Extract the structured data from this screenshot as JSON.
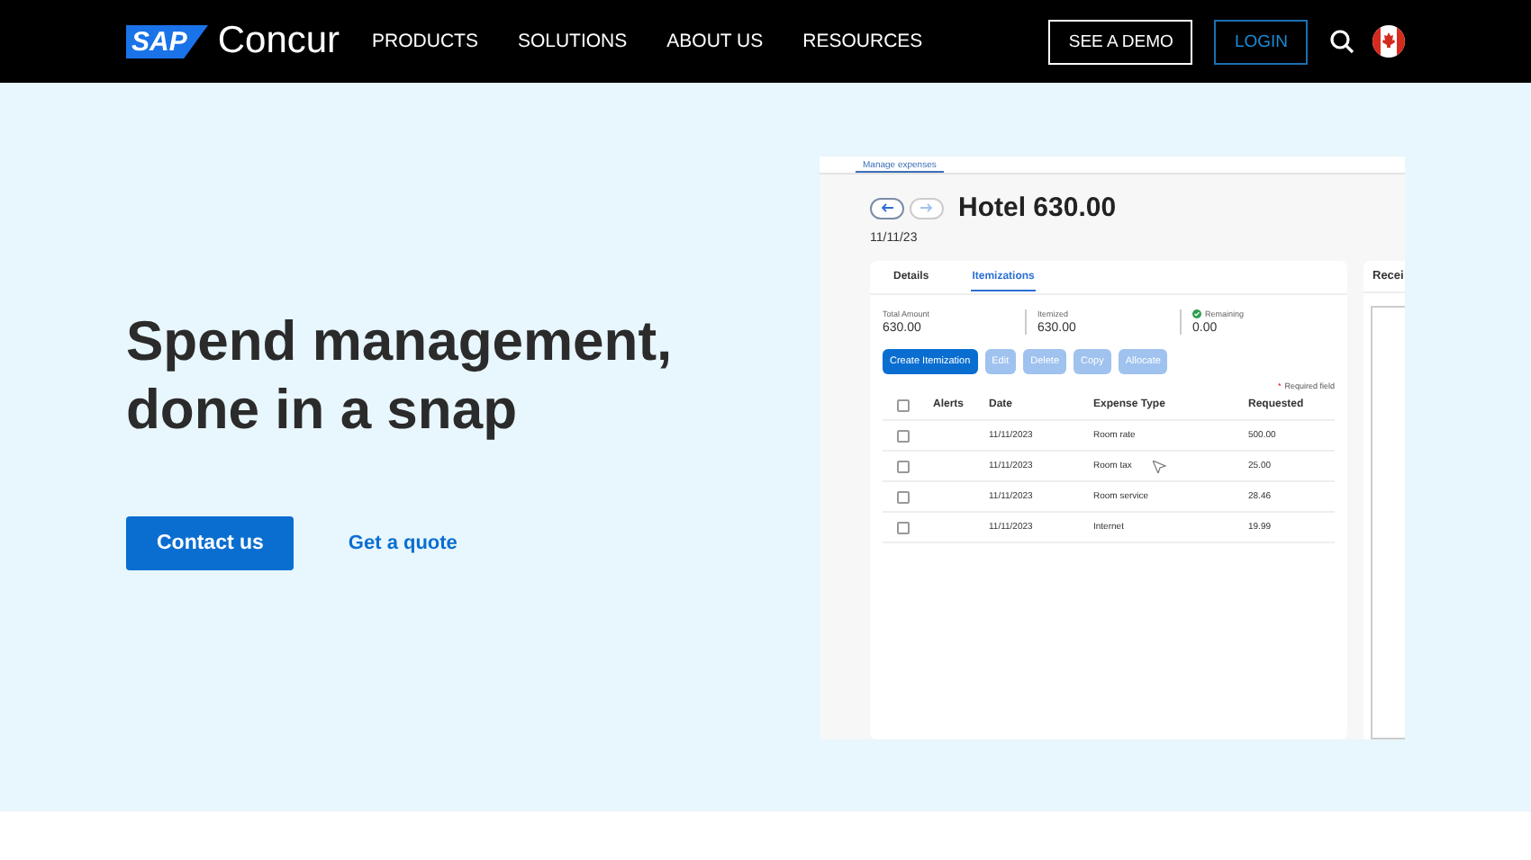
{
  "nav": {
    "logo_mark": "SAP",
    "logo_text": "Concur",
    "links": [
      "PRODUCTS",
      "SOLUTIONS",
      "ABOUT US",
      "RESOURCES"
    ],
    "demo_button": "SEE A DEMO",
    "login_button": "LOGIN"
  },
  "hero": {
    "headline": "Spend management, done in a snap",
    "primary_button": "Contact us",
    "link": "Get a quote"
  },
  "app": {
    "top_tab": "Manage expenses",
    "title": "Hotel 630.00",
    "date": "11/11/23",
    "tabs": [
      {
        "label": "Details",
        "selected": false
      },
      {
        "label": "Itemizations",
        "selected": true
      }
    ],
    "summary": [
      {
        "label": "Total Amount",
        "value": "630.00",
        "kind": "plain"
      },
      {
        "label": "Itemized",
        "value": "630.00",
        "kind": "plain"
      },
      {
        "label": "Remaining",
        "value": "0.00",
        "kind": "ok"
      }
    ],
    "actions": [
      {
        "label": "Create Itemization",
        "disabled": false
      },
      {
        "label": "Edit",
        "disabled": true
      },
      {
        "label": "Delete",
        "disabled": true
      },
      {
        "label": "Copy",
        "disabled": true
      },
      {
        "label": "Allocate",
        "disabled": true
      }
    ],
    "required_mark": "*",
    "required_note": "Required field",
    "select_all_checked": false,
    "columns": [
      "Alerts",
      "Date",
      "Expense Type",
      "Requested"
    ],
    "rows": [
      {
        "checked": false,
        "date": "11/11/2023",
        "type": "Room rate",
        "amount": "500.00"
      },
      {
        "checked": false,
        "date": "11/11/2023",
        "type": "Room tax",
        "amount": "25.00"
      },
      {
        "checked": false,
        "date": "11/11/2023",
        "type": "Room service",
        "amount": "28.46"
      },
      {
        "checked": false,
        "date": "11/11/2023",
        "type": "Internet",
        "amount": "19.99"
      }
    ],
    "side_card_title": "Recei"
  }
}
